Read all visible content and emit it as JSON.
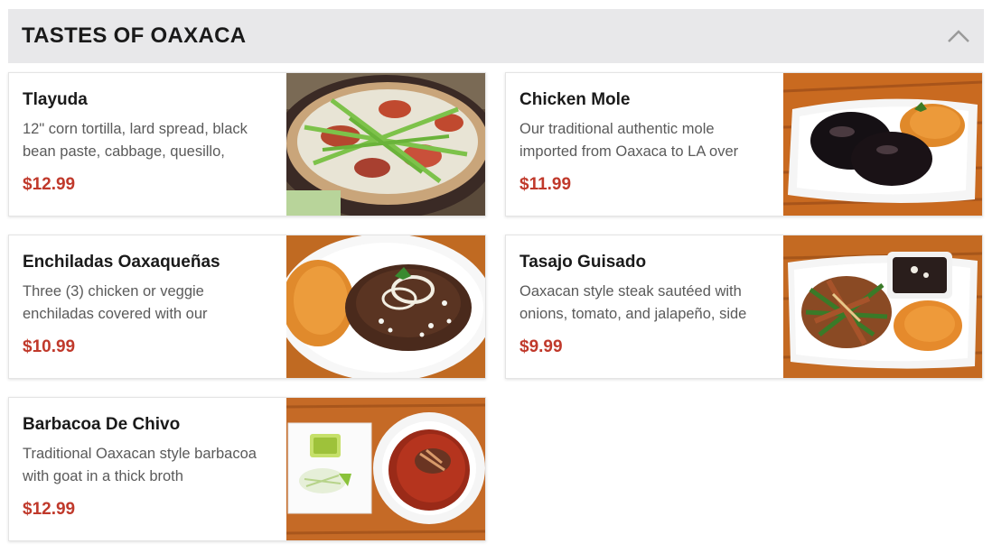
{
  "section": {
    "title": "TASTES OF OAXACA",
    "toggle_icon": "chevron-up-icon"
  },
  "items": [
    {
      "name": "Tlayuda",
      "description": "12\" corn tortilla, lard spread, black bean paste, cabbage, quesillo,",
      "price": "$12.99",
      "image": "tlayuda-photo"
    },
    {
      "name": "Chicken Mole",
      "description": "Our traditional authentic mole imported from Oaxaca to LA over",
      "price": "$11.99",
      "image": "chicken-mole-photo"
    },
    {
      "name": "Enchiladas Oaxaqueñas",
      "description": "Three (3) chicken or veggie enchiladas covered with our",
      "price": "$10.99",
      "image": "enchiladas-photo"
    },
    {
      "name": "Tasajo Guisado",
      "description": "Oaxacan style steak sautéed with onions, tomato, and jalapeño, side",
      "price": "$9.99",
      "image": "tasajo-photo"
    },
    {
      "name": "Barbacoa De Chivo",
      "description": "Traditional Oaxacan style barbacoa with goat in a thick broth",
      "price": "$12.99",
      "image": "barbacoa-photo"
    }
  ],
  "colors": {
    "price": "#c0392b",
    "header_bg": "#e8e8ea"
  }
}
